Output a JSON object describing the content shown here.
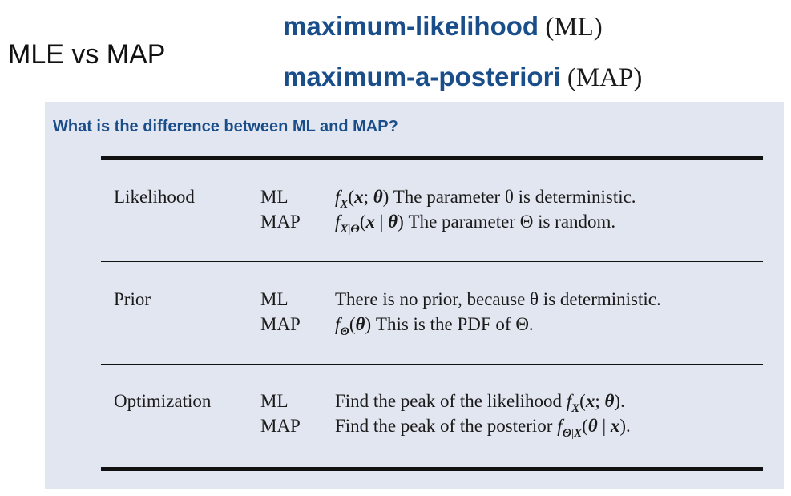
{
  "slide": {
    "title": "MLE vs MAP",
    "terms": [
      {
        "name": "maximum-likelihood",
        "abbr": "(ML)"
      },
      {
        "name": "maximum-a-posteriori",
        "abbr": "(MAP)"
      }
    ]
  },
  "card": {
    "title": "What is the difference between ML and MAP?",
    "rows": [
      {
        "category": "Likelihood",
        "ml_label": "ML",
        "map_label": "MAP",
        "ml_text": "The parameter θ is deterministic.",
        "map_text": "The parameter Θ is random."
      },
      {
        "category": "Prior",
        "ml_label": "ML",
        "map_label": "MAP",
        "ml_text": "There is no prior, because θ is deterministic.",
        "map_text": "This is the PDF of Θ."
      },
      {
        "category": "Optimization",
        "ml_label": "ML",
        "map_label": "MAP",
        "ml_text": "Find the peak of the likelihood",
        "map_text": "Find the peak of the posterior"
      }
    ]
  }
}
